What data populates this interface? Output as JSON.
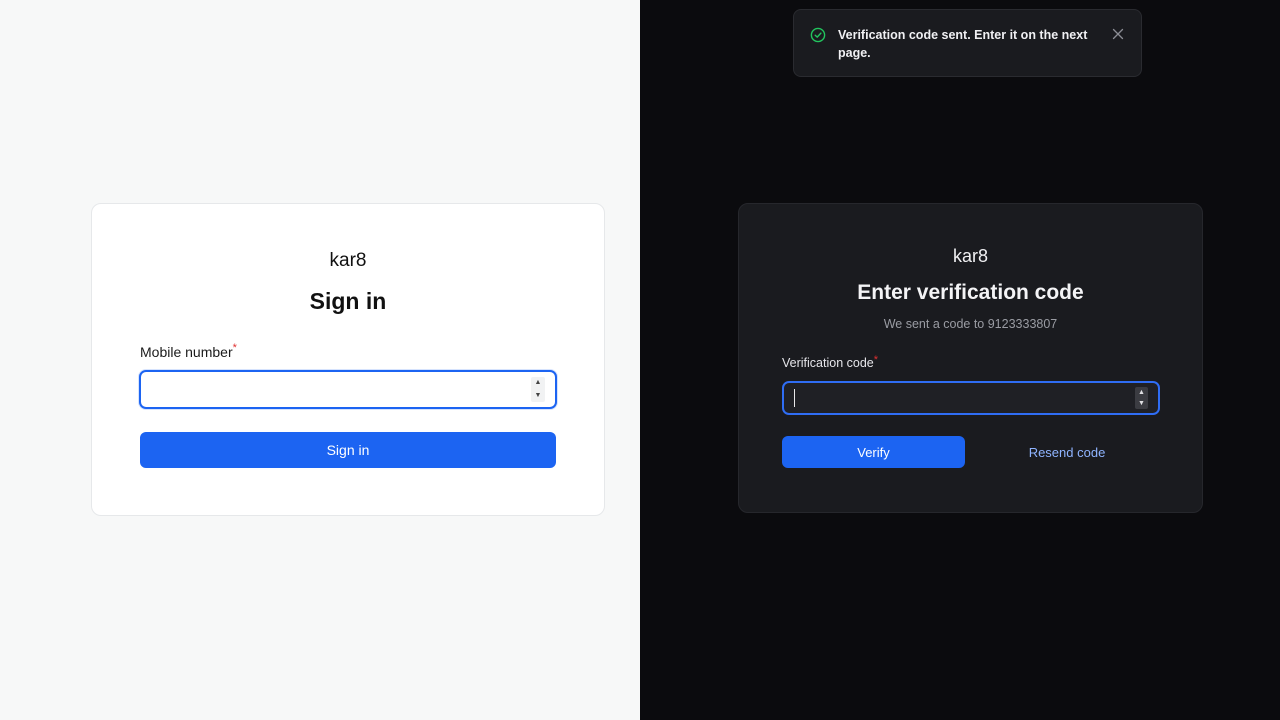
{
  "signin": {
    "brand": "kar8",
    "title": "Sign in",
    "mobile_label": "Mobile number",
    "required_mark": "*",
    "mobile_value": "",
    "button_label": "Sign in"
  },
  "verify": {
    "brand": "kar8",
    "title": "Enter verification code",
    "subtitle": "We sent a code to 9123333807",
    "code_label": "Verification code",
    "required_mark": "*",
    "code_value": "",
    "verify_label": "Verify",
    "resend_label": "Resend code"
  },
  "toast": {
    "message": "Verification code sent. Enter it on the next page.",
    "status_icon": "check-circle-icon",
    "close_icon": "close-icon"
  },
  "colors": {
    "primary": "#1c64f2",
    "success": "#22c55e",
    "danger": "#e03131",
    "link": "#8fb4ff"
  }
}
